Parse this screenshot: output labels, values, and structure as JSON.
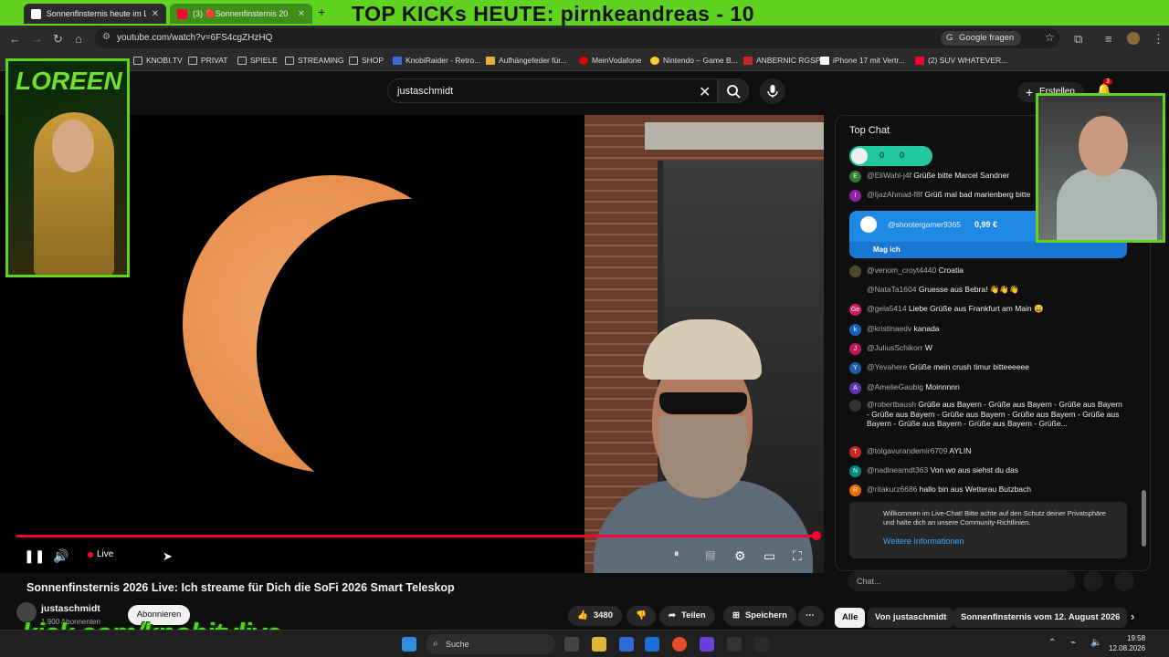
{
  "tabs": [
    {
      "label": "Sonnenfinsternis heute im Live",
      "active": true
    },
    {
      "label": "(3) 🔴Sonnenfinsternis 202",
      "active": false
    }
  ],
  "banner": "TOP KICKs HEUTE: pirnkeandreas - 10",
  "url": "youtube.com/watch?v=6FS4cgZHzHQ",
  "google_ask": "Google fragen",
  "bookmarks": [
    "KNOBI.TV",
    "PRIVAT",
    "SPIELE",
    "STREAMING",
    "SHOP",
    "KnobiRaider - Retro...",
    "Aufhängefeder für...",
    "MeinVodafone",
    "Nintendo – Game B...",
    "ANBERNIC RGSP",
    "iPhone 17 mit Vertr...",
    "(2) SUV WHATEVER..."
  ],
  "search": {
    "value": "justaschmidt"
  },
  "create_label": "Erstellen",
  "notifications": "3",
  "player": {
    "live_label": "Live"
  },
  "video": {
    "title": "Sonnenfinsternis 2026 Live: Ich streame für Dich die SoFi 2026 Smart Teleskop",
    "channel": "justaschmidt",
    "subscribers": "1.900 Abonnenten",
    "subscribe_label": "Abonnieren",
    "likes": "3480",
    "share_label": "Teilen",
    "save_label": "Speichern"
  },
  "overlay": {
    "loreen": "LOREEN",
    "kick": "kick.com/knobitvlive"
  },
  "chat": {
    "header": "Top Chat",
    "poll": [
      "0",
      "0"
    ],
    "messages_top": [
      {
        "initial": "E",
        "color": "#2e7d32",
        "author": "@EliWahl-j4f",
        "text": "Grüße bitte Marcel Sandner"
      },
      {
        "initial": "I",
        "color": "#8e24aa",
        "author": "@IjazAhmad-f8f",
        "text": "Grüß mal bad marienberg bitte"
      }
    ],
    "superchat": {
      "author": "@shootergamer9365",
      "amount": "0,99 €",
      "sub": "Mag ich"
    },
    "messages": [
      {
        "initial": "",
        "color": "#4a4a2a",
        "author": "@venom_croyt4440",
        "text": "Croatia"
      },
      {
        "initial": "",
        "color": "#111111",
        "author": "@NataTa1604",
        "text": "Gruesse aus Bebra! 👋👋👋"
      },
      {
        "initial": "Ge",
        "color": "#d81b60",
        "author": "@gela5414",
        "text": "Liebe Grüße aus Frankfurt am Main 😄"
      },
      {
        "initial": "k",
        "color": "#1565c0",
        "author": "@kristinaedv",
        "text": "kanada"
      },
      {
        "initial": "J",
        "color": "#c2185b",
        "author": "@JuliusSchikorr",
        "text": "W"
      },
      {
        "initial": "Y",
        "color": "#1e5fa8",
        "author": "@Yevahere",
        "text": "Grüße mein crush timur bitteeeeee"
      },
      {
        "initial": "A",
        "color": "#5e35b1",
        "author": "@AmelieGaubig",
        "text": "Moinnnnn"
      },
      {
        "initial": "",
        "color": "#333333",
        "author": "@robertbaush",
        "text": "Grüße aus Bayern - Grüße aus Bayern - Grüße aus Bayern - Grüße aus Bayern - Grüße aus Bayern - Grüße aus Bayern - Grüße aus Bayern - Grüße aus Bayern - Grüße aus Bayern - Grüße..."
      },
      {
        "initial": "T",
        "color": "#c62828",
        "author": "@tolgavurandemir6709",
        "text": "AYLIN"
      },
      {
        "initial": "N",
        "color": "#00897b",
        "author": "@nadineamdt363",
        "text": "Von wo aus siehst du das"
      },
      {
        "initial": "R",
        "color": "#ef6c00",
        "author": "@ritakurz6686",
        "text": "hallo bin aus Wetterau Butzbach"
      }
    ],
    "welcome": "Willkommen im Live-Chat! Bitte achte auf den Schutz deiner Privatsphäre und halte dich an unsere Community-Richtlinien.",
    "welcome_link": "Weitere Informationen",
    "input_placeholder": "Chat..."
  },
  "chips": [
    "Alle",
    "Von justaschmidt",
    "Sonnenfinsternis vom 12. August 2026"
  ],
  "taskbar": {
    "search": "Suche",
    "time": "19:58",
    "date": "12.08.2026"
  },
  "colors": {
    "accent": "#ff0033",
    "overlay_green": "#5fd320",
    "superchat": "#1e88e5"
  }
}
